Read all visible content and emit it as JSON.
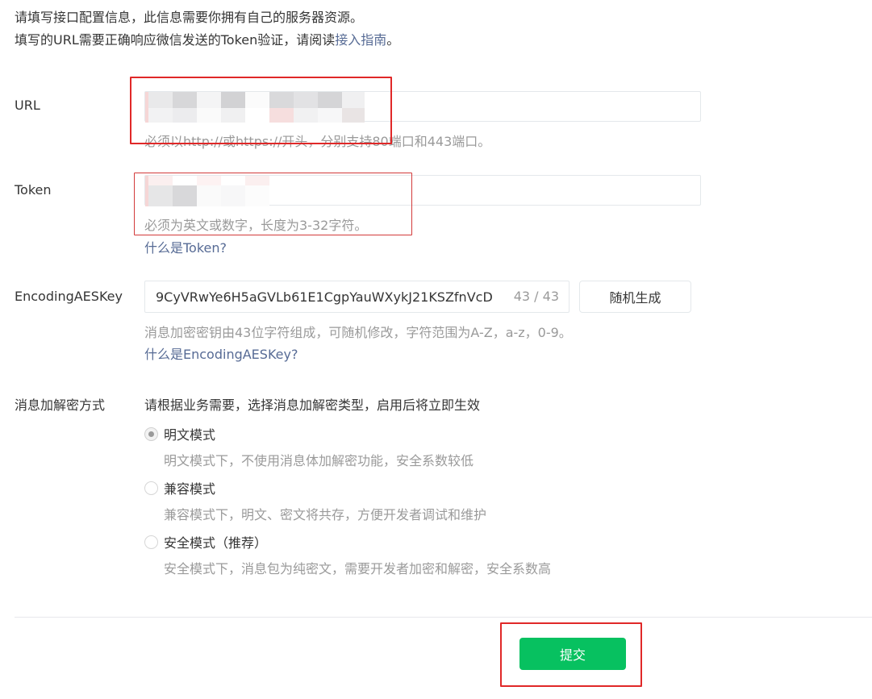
{
  "intro": {
    "line1": "请填写接口配置信息，此信息需要你拥有自己的服务器资源。",
    "line2_prefix": "填写的URL需要正确响应微信发送的Token验证，请阅读",
    "line2_link": "接入指南",
    "line2_suffix": "。"
  },
  "url": {
    "label": "URL",
    "tip": "必须以http://或https://开头，分别支持80端口和443端口。"
  },
  "token": {
    "label": "Token",
    "tip": "必须为英文或数字，长度为3-32字符。",
    "help_link": "什么是Token?"
  },
  "aes": {
    "label": "EncodingAESKey",
    "value": "9CyVRwYe6H5aGVLb61E1CgpYauWXykJ21KSZfnVcD",
    "count": "43 / 43",
    "generate_button": "随机生成",
    "tip": "消息加密密钥由43位字符组成，可随机修改，字符范围为A-Z，a-z，0-9。",
    "help_link": "什么是EncodingAESKey?"
  },
  "encryption": {
    "label": "消息加解密方式",
    "description": "请根据业务需要，选择消息加解密类型，启用后将立即生效",
    "options": [
      {
        "label": "明文模式",
        "desc": "明文模式下，不使用消息体加解密功能，安全系数较低",
        "checked": true
      },
      {
        "label": "兼容模式",
        "desc": "兼容模式下，明文、密文将共存，方便开发者调试和维护",
        "checked": false
      },
      {
        "label": "安全模式（推荐）",
        "desc": "安全模式下，消息包为纯密文，需要开发者加密和解密，安全系数高",
        "checked": false
      }
    ]
  },
  "submit_button": "提交",
  "colors": {
    "primary": "#07c160",
    "link": "#576b95",
    "annotation": "#e02828"
  }
}
